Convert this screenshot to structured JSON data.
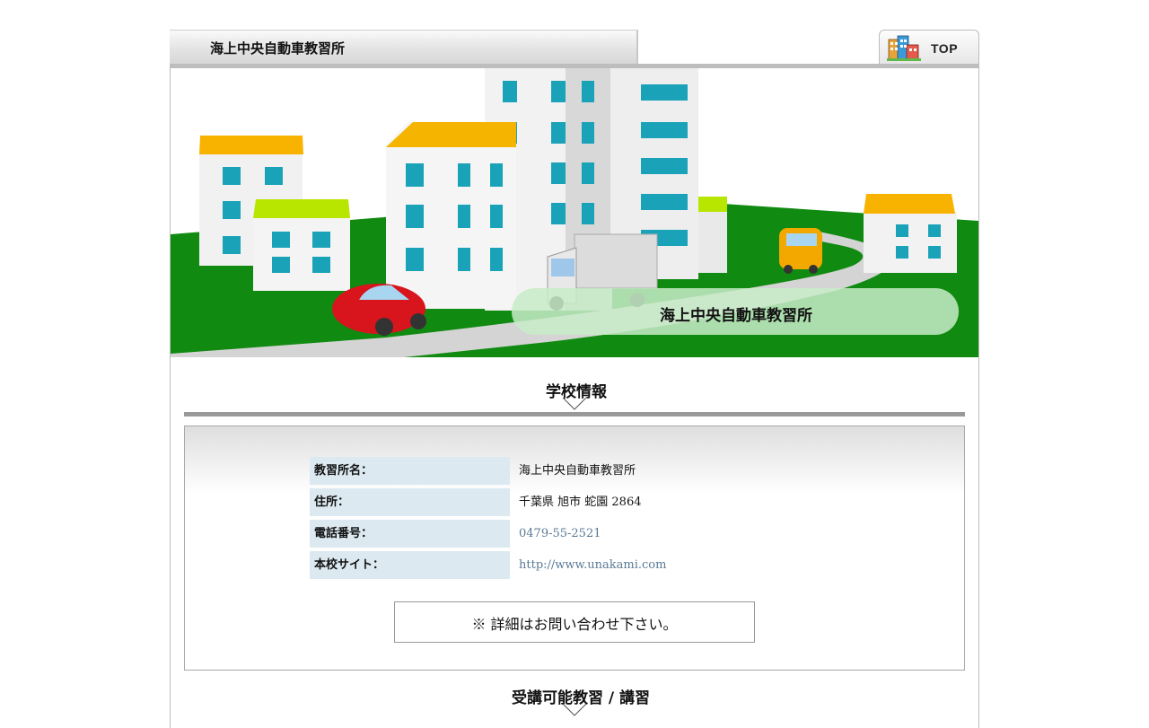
{
  "header": {
    "title": "海上中央自動車教習所"
  },
  "nav": {
    "top_label": "TOP",
    "top_icon": "buildings-icon"
  },
  "hero": {
    "caption": "海上中央自動車教習所"
  },
  "school_info": {
    "title": "学校情報",
    "rows": [
      {
        "label": "教習所名：",
        "value": "海上中央自動車教習所"
      },
      {
        "label": "住所：",
        "value": "千葉県 旭市 蛇園 2864"
      },
      {
        "label": "電話番号：",
        "value": "0479-55-2521"
      },
      {
        "label": "本校サイト：",
        "value": "http://www.unakami.com"
      }
    ],
    "note": "※ 詳細はお問い合わせ下さい。"
  },
  "courses": {
    "title": "受講可能教習 / 講習"
  },
  "colors": {
    "key_bg": "#dce9f0",
    "link": "#5a7a95",
    "ground": "#118a11",
    "rule": "#999999"
  }
}
